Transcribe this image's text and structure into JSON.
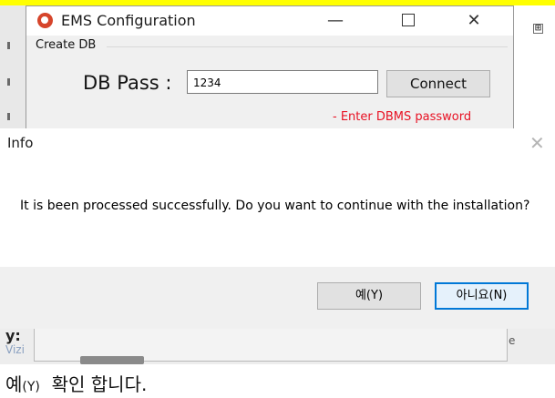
{
  "ems_window": {
    "title": "EMS Configuration",
    "controls": {
      "minimize": "—",
      "maximize": "",
      "close": "✕"
    },
    "group_label": "Create DB",
    "db_pass_label": "DB Pass :",
    "db_pass_value": "1234",
    "connect_label": "Connect",
    "hint": "- Enter DBMS password"
  },
  "background": {
    "expand_glyph": "⊞",
    "fragment_a": "y:",
    "fragment_b": "Vizi",
    "edge_char": "e"
  },
  "info_dialog": {
    "title": "Info",
    "close_glyph": "✕",
    "message": "It is been processed successfully. Do you want to continue with the installation?",
    "yes_label": "예(Y)",
    "no_label": "아니요(N)"
  },
  "caption": {
    "prefix": "예",
    "code": "(Y)",
    "rest": "  확인 합니다."
  },
  "colors": {
    "hint_red": "#e81123",
    "focus_blue": "#0078d7",
    "caption_bar": "#ffff00"
  },
  "icons": {
    "app_logo": "ems-logo-icon",
    "expand": "plus-box-icon",
    "close": "close-icon"
  }
}
